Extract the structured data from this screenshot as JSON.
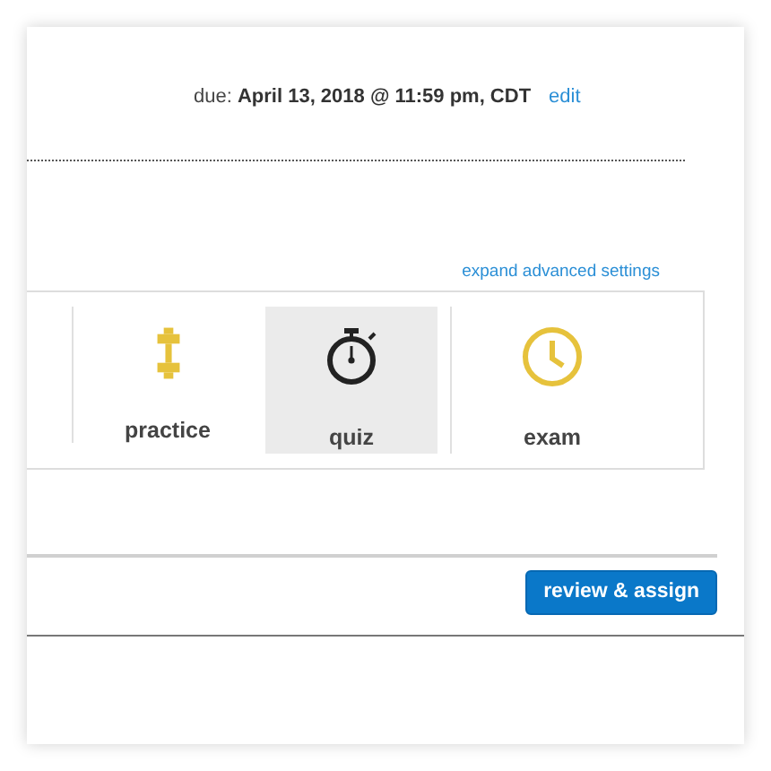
{
  "due": {
    "text": "due: **April 13, 2018 @ 11:59 pm, CDT**",
    "link": "edit"
  },
  "advanced_link": "expand advanced settings",
  "modes": [
    {
      "label": "practice",
      "kind": "dumbbell",
      "selected": false
    },
    {
      "label": "quiz",
      "kind": "stopwatch",
      "selected": true
    },
    {
      "label": "exam",
      "kind": "clock",
      "selected": false
    }
  ],
  "button": "review & assign"
}
